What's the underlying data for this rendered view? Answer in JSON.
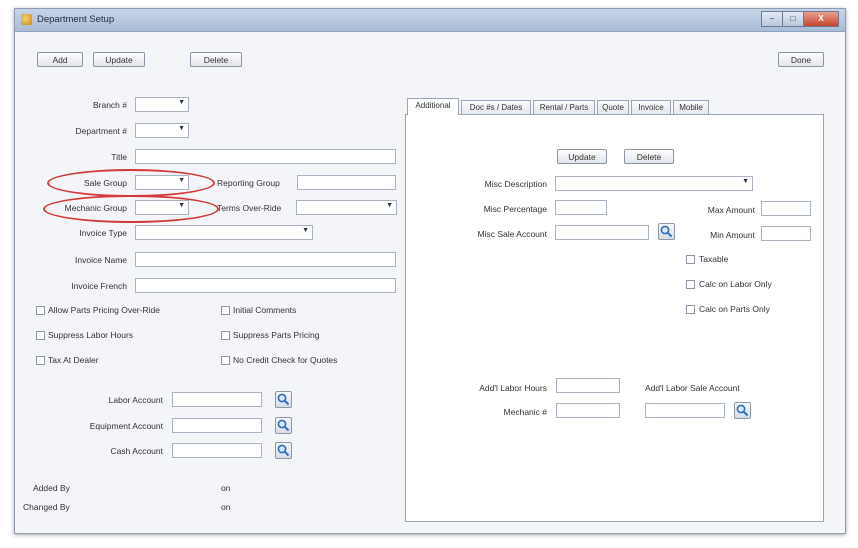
{
  "window": {
    "title": "Department Setup",
    "controls": {
      "minimize": "–",
      "maximize": "□",
      "close": "X"
    }
  },
  "toolbar": {
    "add": "Add",
    "update": "Update",
    "delete": "Delete",
    "done": "Done"
  },
  "form": {
    "branch_label": "Branch #",
    "department_label": "Department #",
    "title_label": "Title",
    "sale_group_label": "Sale Group",
    "reporting_group_label": "Reporting Group",
    "mechanic_group_label": "Mechanic Group",
    "terms_override_label": "Terms Over-Ride",
    "invoice_type_label": "Invoice Type",
    "invoice_name_label": "Invoice Name",
    "invoice_french_label": "Invoice French"
  },
  "checkboxes": {
    "allow_parts_pricing": "Allow Parts Pricing Over-Ride",
    "initial_comments": "Initial Comments",
    "suppress_labor_hours": "Suppress Labor Hours",
    "suppress_parts_pricing": "Suppress Parts Pricing",
    "tax_at_dealer": "Tax At Dealer",
    "no_credit_check": "No Credit Check for Quotes"
  },
  "accounts": {
    "labor_account_label": "Labor Account",
    "equipment_account_label": "Equipment Account",
    "cash_account_label": "Cash Account"
  },
  "audit": {
    "added_by_label": "Added By",
    "added_on": "on",
    "changed_by_label": "Changed By",
    "changed_on": "on"
  },
  "tabs": [
    "Additional",
    "Doc #s / Dates",
    "Rental / Parts",
    "Quote",
    "Invoice",
    "Mobile"
  ],
  "additional": {
    "update": "Update",
    "delete": "Delete",
    "misc_description_label": "Misc Description",
    "misc_percentage_label": "Misc Percentage",
    "max_amount_label": "Max Amount",
    "misc_sale_account_label": "Misc Sale Account",
    "min_amount_label": "Min Amount",
    "taxable": "Taxable",
    "calc_labor_only": "Calc on Labor Only",
    "calc_parts_only": "Calc on Parts Only",
    "addl_labor_hours_label": "Add'l Labor Hours",
    "addl_labor_sale_account_label": "Add'l Labor Sale Account",
    "mechanic_label": "Mechanic #"
  },
  "icons": {
    "search": "search-icon",
    "dropdown": "chevron-down-icon"
  },
  "colors": {
    "highlight": "#d33b3b",
    "titlebar": "#b5c6de"
  }
}
